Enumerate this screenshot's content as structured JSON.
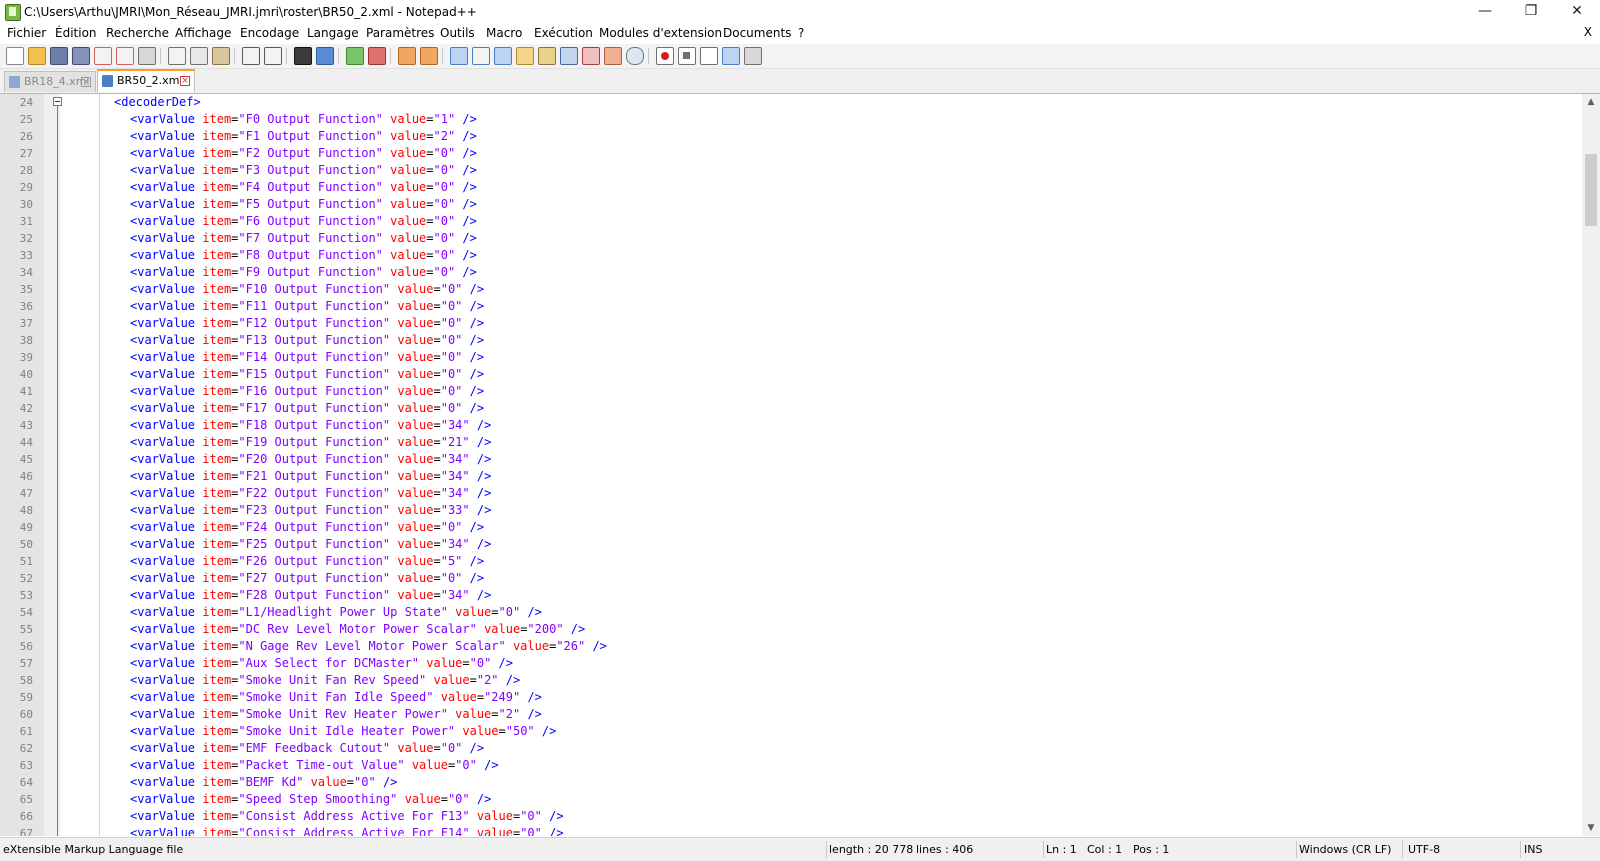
{
  "window": {
    "title": "C:\\Users\\Arthu\\JMRI\\Mon_Réseau_JMRI.jmri\\roster\\BR50_2.xml - Notepad++",
    "minimize": "—",
    "restore": "❐",
    "close": "✕"
  },
  "menu": {
    "items": [
      "Fichier",
      "Édition",
      "Recherche",
      "Affichage",
      "Encodage",
      "Langage",
      "Paramètres",
      "Outils",
      "Macro",
      "Exécution",
      "Modules d'extension",
      "Documents",
      "?"
    ],
    "close_doc": "X"
  },
  "toolbar": {
    "icons": [
      "new-file-icon",
      "open-file-icon",
      "save-icon",
      "save-all-icon",
      "close-icon",
      "close-all-icon",
      "print-icon",
      "cut-icon",
      "copy-icon",
      "paste-icon",
      "undo-icon",
      "redo-icon",
      "find-icon",
      "replace-icon",
      "zoom-in-icon",
      "zoom-out-icon",
      "sync-vertical-icon",
      "sync-horizontal-icon",
      "word-wrap-icon",
      "show-all-chars-icon",
      "indent-guide-icon",
      "user-language-icon",
      "document-map-icon",
      "function-list-icon",
      "folder-workspace-icon",
      "monitoring-icon",
      "record-macro-icon",
      "stop-macro-icon",
      "play-macro-icon",
      "run-macro-multiple-icon",
      "save-macro-icon"
    ]
  },
  "tabs": [
    {
      "label": "BR18_4.xml",
      "active": false
    },
    {
      "label": "BR50_2.xml",
      "active": true
    }
  ],
  "editor": {
    "lines": [
      {
        "n": "24",
        "indent": 0,
        "tag": "<decoderDef>",
        "kind": "open"
      },
      {
        "n": "25",
        "indent": 1,
        "tag": "<varValue",
        "item": "\"F0 Output Function\"",
        "value": "\"1\"",
        "end": "/>"
      },
      {
        "n": "26",
        "indent": 1,
        "tag": "<varValue",
        "item": "\"F1 Output Function\"",
        "value": "\"2\"",
        "end": "/>"
      },
      {
        "n": "27",
        "indent": 1,
        "tag": "<varValue",
        "item": "\"F2 Output Function\"",
        "value": "\"0\"",
        "end": "/>"
      },
      {
        "n": "28",
        "indent": 1,
        "tag": "<varValue",
        "item": "\"F3 Output Function\"",
        "value": "\"0\"",
        "end": "/>"
      },
      {
        "n": "29",
        "indent": 1,
        "tag": "<varValue",
        "item": "\"F4 Output Function\"",
        "value": "\"0\"",
        "end": "/>"
      },
      {
        "n": "30",
        "indent": 1,
        "tag": "<varValue",
        "item": "\"F5 Output Function\"",
        "value": "\"0\"",
        "end": "/>"
      },
      {
        "n": "31",
        "indent": 1,
        "tag": "<varValue",
        "item": "\"F6 Output Function\"",
        "value": "\"0\"",
        "end": "/>"
      },
      {
        "n": "32",
        "indent": 1,
        "tag": "<varValue",
        "item": "\"F7 Output Function\"",
        "value": "\"0\"",
        "end": "/>"
      },
      {
        "n": "33",
        "indent": 1,
        "tag": "<varValue",
        "item": "\"F8 Output Function\"",
        "value": "\"0\"",
        "end": "/>"
      },
      {
        "n": "34",
        "indent": 1,
        "tag": "<varValue",
        "item": "\"F9 Output Function\"",
        "value": "\"0\"",
        "end": "/>"
      },
      {
        "n": "35",
        "indent": 1,
        "tag": "<varValue",
        "item": "\"F10 Output Function\"",
        "value": "\"0\"",
        "end": "/>"
      },
      {
        "n": "36",
        "indent": 1,
        "tag": "<varValue",
        "item": "\"F11 Output Function\"",
        "value": "\"0\"",
        "end": "/>"
      },
      {
        "n": "37",
        "indent": 1,
        "tag": "<varValue",
        "item": "\"F12 Output Function\"",
        "value": "\"0\"",
        "end": "/>"
      },
      {
        "n": "38",
        "indent": 1,
        "tag": "<varValue",
        "item": "\"F13 Output Function\"",
        "value": "\"0\"",
        "end": "/>"
      },
      {
        "n": "39",
        "indent": 1,
        "tag": "<varValue",
        "item": "\"F14 Output Function\"",
        "value": "\"0\"",
        "end": "/>"
      },
      {
        "n": "40",
        "indent": 1,
        "tag": "<varValue",
        "item": "\"F15 Output Function\"",
        "value": "\"0\"",
        "end": "/>"
      },
      {
        "n": "41",
        "indent": 1,
        "tag": "<varValue",
        "item": "\"F16 Output Function\"",
        "value": "\"0\"",
        "end": "/>"
      },
      {
        "n": "42",
        "indent": 1,
        "tag": "<varValue",
        "item": "\"F17 Output Function\"",
        "value": "\"0\"",
        "end": "/>"
      },
      {
        "n": "43",
        "indent": 1,
        "tag": "<varValue",
        "item": "\"F18 Output Function\"",
        "value": "\"34\"",
        "end": "/>"
      },
      {
        "n": "44",
        "indent": 1,
        "tag": "<varValue",
        "item": "\"F19 Output Function\"",
        "value": "\"21\"",
        "end": "/>"
      },
      {
        "n": "45",
        "indent": 1,
        "tag": "<varValue",
        "item": "\"F20 Output Function\"",
        "value": "\"34\"",
        "end": "/>"
      },
      {
        "n": "46",
        "indent": 1,
        "tag": "<varValue",
        "item": "\"F21 Output Function\"",
        "value": "\"34\"",
        "end": "/>"
      },
      {
        "n": "47",
        "indent": 1,
        "tag": "<varValue",
        "item": "\"F22 Output Function\"",
        "value": "\"34\"",
        "end": "/>"
      },
      {
        "n": "48",
        "indent": 1,
        "tag": "<varValue",
        "item": "\"F23 Output Function\"",
        "value": "\"33\"",
        "end": "/>"
      },
      {
        "n": "49",
        "indent": 1,
        "tag": "<varValue",
        "item": "\"F24 Output Function\"",
        "value": "\"0\"",
        "end": "/>"
      },
      {
        "n": "50",
        "indent": 1,
        "tag": "<varValue",
        "item": "\"F25 Output Function\"",
        "value": "\"34\"",
        "end": "/>"
      },
      {
        "n": "51",
        "indent": 1,
        "tag": "<varValue",
        "item": "\"F26 Output Function\"",
        "value": "\"5\"",
        "end": "/>"
      },
      {
        "n": "52",
        "indent": 1,
        "tag": "<varValue",
        "item": "\"F27 Output Function\"",
        "value": "\"0\"",
        "end": "/>"
      },
      {
        "n": "53",
        "indent": 1,
        "tag": "<varValue",
        "item": "\"F28 Output Function\"",
        "value": "\"34\"",
        "end": "/>"
      },
      {
        "n": "54",
        "indent": 1,
        "tag": "<varValue",
        "item": "\"L1/Headlight Power Up State\"",
        "value": "\"0\"",
        "end": "/>"
      },
      {
        "n": "55",
        "indent": 1,
        "tag": "<varValue",
        "item": "\"DC Rev Level Motor Power Scalar\"",
        "value": "\"200\"",
        "end": "/>"
      },
      {
        "n": "56",
        "indent": 1,
        "tag": "<varValue",
        "item": "\"N Gage Rev Level Motor Power Scalar\"",
        "value": "\"26\"",
        "end": "/>"
      },
      {
        "n": "57",
        "indent": 1,
        "tag": "<varValue",
        "item": "\"Aux Select for DCMaster\"",
        "value": "\"0\"",
        "end": "/>"
      },
      {
        "n": "58",
        "indent": 1,
        "tag": "<varValue",
        "item": "\"Smoke Unit Fan Rev Speed\"",
        "value": "\"2\"",
        "end": "/>"
      },
      {
        "n": "59",
        "indent": 1,
        "tag": "<varValue",
        "item": "\"Smoke Unit Fan Idle Speed\"",
        "value": "\"249\"",
        "end": "/>"
      },
      {
        "n": "60",
        "indent": 1,
        "tag": "<varValue",
        "item": "\"Smoke Unit Rev Heater Power\"",
        "value": "\"2\"",
        "end": "/>"
      },
      {
        "n": "61",
        "indent": 1,
        "tag": "<varValue",
        "item": "\"Smoke Unit Idle Heater Power\"",
        "value": "\"50\"",
        "end": "/>"
      },
      {
        "n": "62",
        "indent": 1,
        "tag": "<varValue",
        "item": "\"EMF Feedback Cutout\"",
        "value": "\"0\"",
        "end": "/>"
      },
      {
        "n": "63",
        "indent": 1,
        "tag": "<varValue",
        "item": "\"Packet Time-out Value\"",
        "value": "\"0\"",
        "end": "/>"
      },
      {
        "n": "64",
        "indent": 1,
        "tag": "<varValue",
        "item": "\"BEMF Kd\"",
        "value": "\"0\"",
        "end": "/>"
      },
      {
        "n": "65",
        "indent": 1,
        "tag": "<varValue",
        "item": "\"Speed Step Smoothing\"",
        "value": "\"0\"",
        "end": "/>"
      },
      {
        "n": "66",
        "indent": 1,
        "tag": "<varValue",
        "item": "\"Consist Address Active For F13\"",
        "value": "\"0\"",
        "end": "/>"
      },
      {
        "n": "67",
        "indent": 1,
        "tag": "<varValue",
        "item": "\"Consist Address Active For F14\"",
        "value": "\"0\"",
        "end": "/>"
      }
    ]
  },
  "status": {
    "language": "eXtensible Markup Language file",
    "length": "length : 20 778",
    "lines": "lines : 406",
    "ln": "Ln : 1",
    "col": "Col : 1",
    "pos": "Pos : 1",
    "eol": "Windows (CR LF)",
    "encoding": "UTF-8",
    "mode": "INS"
  },
  "colors": {
    "tag": "#0000ff",
    "attr": "#ff0000",
    "string": "#8000ff",
    "active_tab_accent": "#fa9b2b"
  }
}
